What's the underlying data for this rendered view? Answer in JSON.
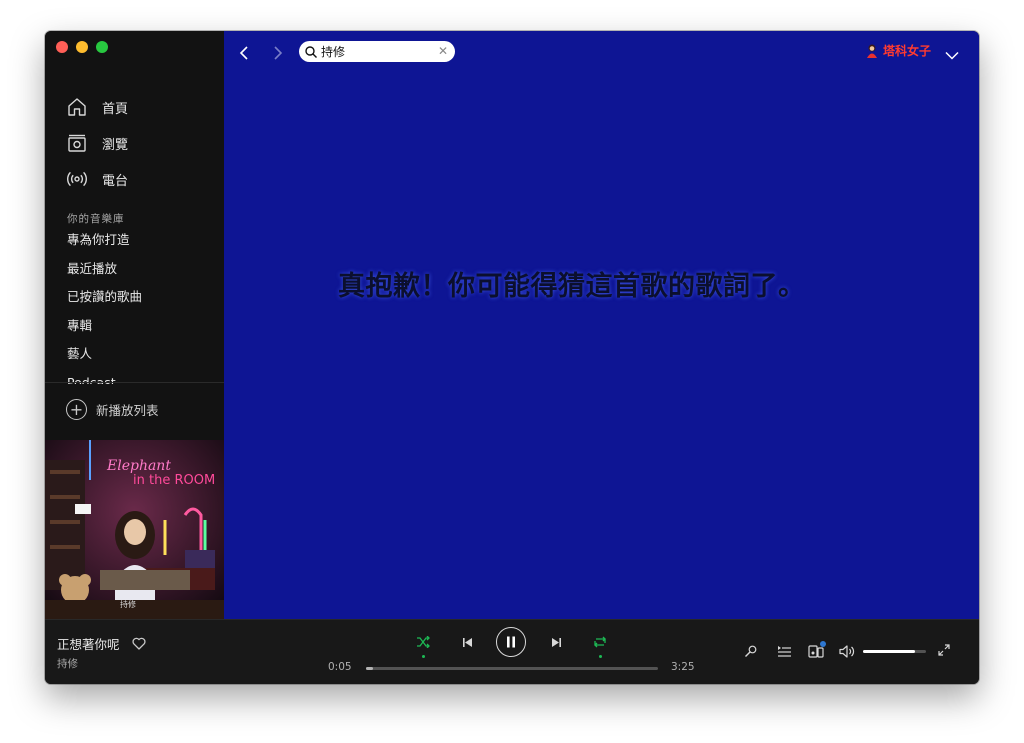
{
  "window": {
    "traffic_lights": [
      "#ff5f57",
      "#febc2e",
      "#28c840"
    ]
  },
  "sidebar": {
    "nav": [
      {
        "label": "首頁",
        "icon": "home-icon"
      },
      {
        "label": "瀏覽",
        "icon": "browse-icon"
      },
      {
        "label": "電台",
        "icon": "radio-icon"
      }
    ],
    "library_title": "你的音樂庫",
    "library_items": [
      "專為你打造",
      "最近播放",
      "已按讚的歌曲",
      "專輯",
      "藝人",
      "Podcast"
    ],
    "new_playlist_label": "新播放列表"
  },
  "cover": {
    "title_lines": [
      "Elephant",
      "in the ROOM"
    ],
    "artist": "持修"
  },
  "topbar": {
    "search_value": "持修",
    "user_name": "塔科女子"
  },
  "main": {
    "message": "真抱歉！你可能得猜這首歌的歌詞了。",
    "background": "#0e1594"
  },
  "player": {
    "track_title": "正想著你呢",
    "track_artist": "持修",
    "time_elapsed": "0:05",
    "time_total": "3:25",
    "progress": 0.025,
    "volume": 0.83,
    "accent": "#1db954",
    "shuffle_on": true,
    "repeat_on": true,
    "playing": true
  }
}
